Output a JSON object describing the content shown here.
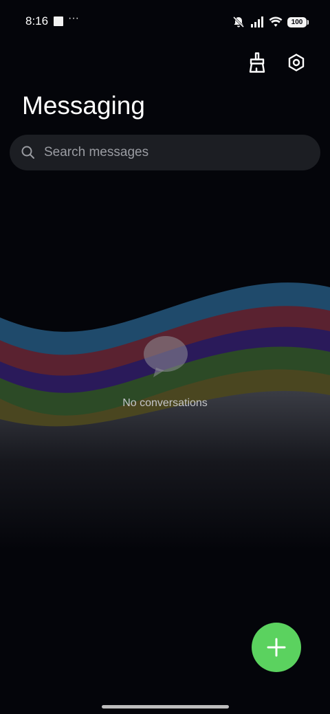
{
  "status_bar": {
    "time": "8:16",
    "dots": "···",
    "battery": "100",
    "icons": [
      "notification-square-icon",
      "mute-bell-icon",
      "signal-icon",
      "wifi-icon",
      "battery-icon"
    ]
  },
  "header": {
    "title": "Messaging",
    "actions": [
      "clean-brush-icon",
      "settings-icon"
    ]
  },
  "search": {
    "placeholder": "Search messages",
    "value": "",
    "icon": "search-icon"
  },
  "empty_state": {
    "icon": "chat-bubble-icon",
    "text": "No conversations"
  },
  "fab": {
    "icon": "plus-icon",
    "color": "#5bd25f"
  },
  "colors": {
    "background": "#04050a",
    "search_bg": "#1c1e23",
    "wave_blue": "#1f4a6b",
    "wave_red": "#5a2230",
    "wave_purple": "#2a1a5a",
    "wave_green": "#2c4a26",
    "wave_olive": "#4a4620",
    "fab": "#5bd25f"
  }
}
